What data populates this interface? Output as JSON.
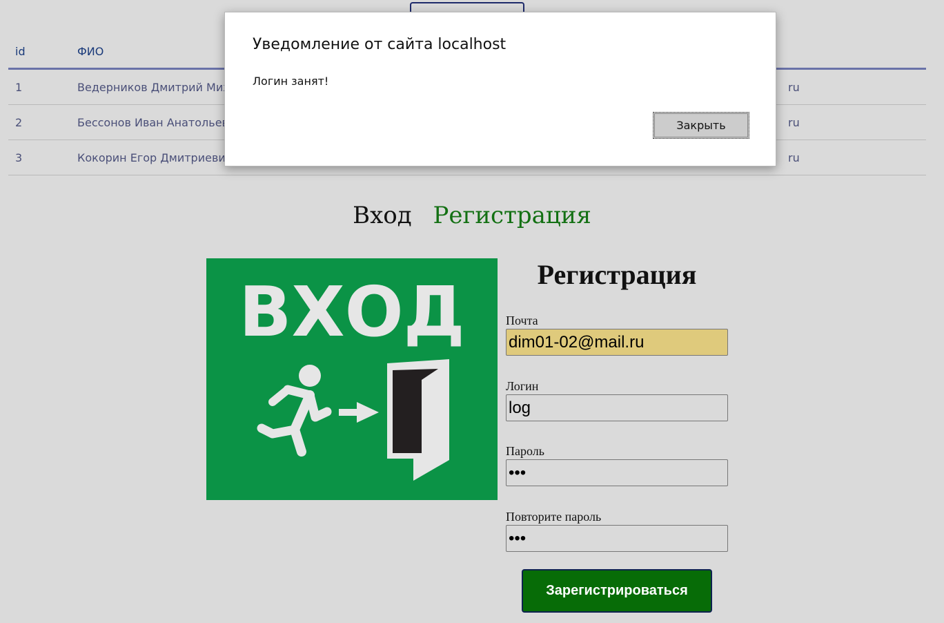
{
  "table": {
    "headers": {
      "id": "id",
      "fio": "ФИО"
    },
    "rows": [
      {
        "id": "1",
        "fio": "Ведерников Дмитрий Михайлович",
        "email_tail": "ru"
      },
      {
        "id": "2",
        "fio": "Бессонов Иван Анатольевич",
        "email_tail": "ru"
      },
      {
        "id": "3",
        "fio": "Кокорин Егор Дмитриевич",
        "email_tail": "ru"
      }
    ]
  },
  "auth_tabs": {
    "login": "Вход",
    "register": "Регистрация"
  },
  "exit_sign": {
    "text": "ВХОД",
    "colors": {
      "background": "#0b9346",
      "glyphs": "#e6e6e6",
      "door": "#231f20"
    }
  },
  "form": {
    "title": "Регистрация",
    "email": {
      "label": "Почта",
      "value": "dim01-02@mail.ru"
    },
    "login": {
      "label": "Логин",
      "value": "log"
    },
    "password": {
      "label": "Пароль",
      "value": "•••"
    },
    "password_repeat": {
      "label": "Повторите пароль",
      "value": "•••"
    },
    "submit_label": "Зарегистрироваться"
  },
  "dialog": {
    "title": "Уведомление от сайта localhost",
    "message": "Логин занят!",
    "close_label": "Закрыть"
  },
  "colors": {
    "page_background": "#dadada",
    "accent_green": "#137013",
    "button_green": "#076c07",
    "autofill": "#dfca7c"
  }
}
